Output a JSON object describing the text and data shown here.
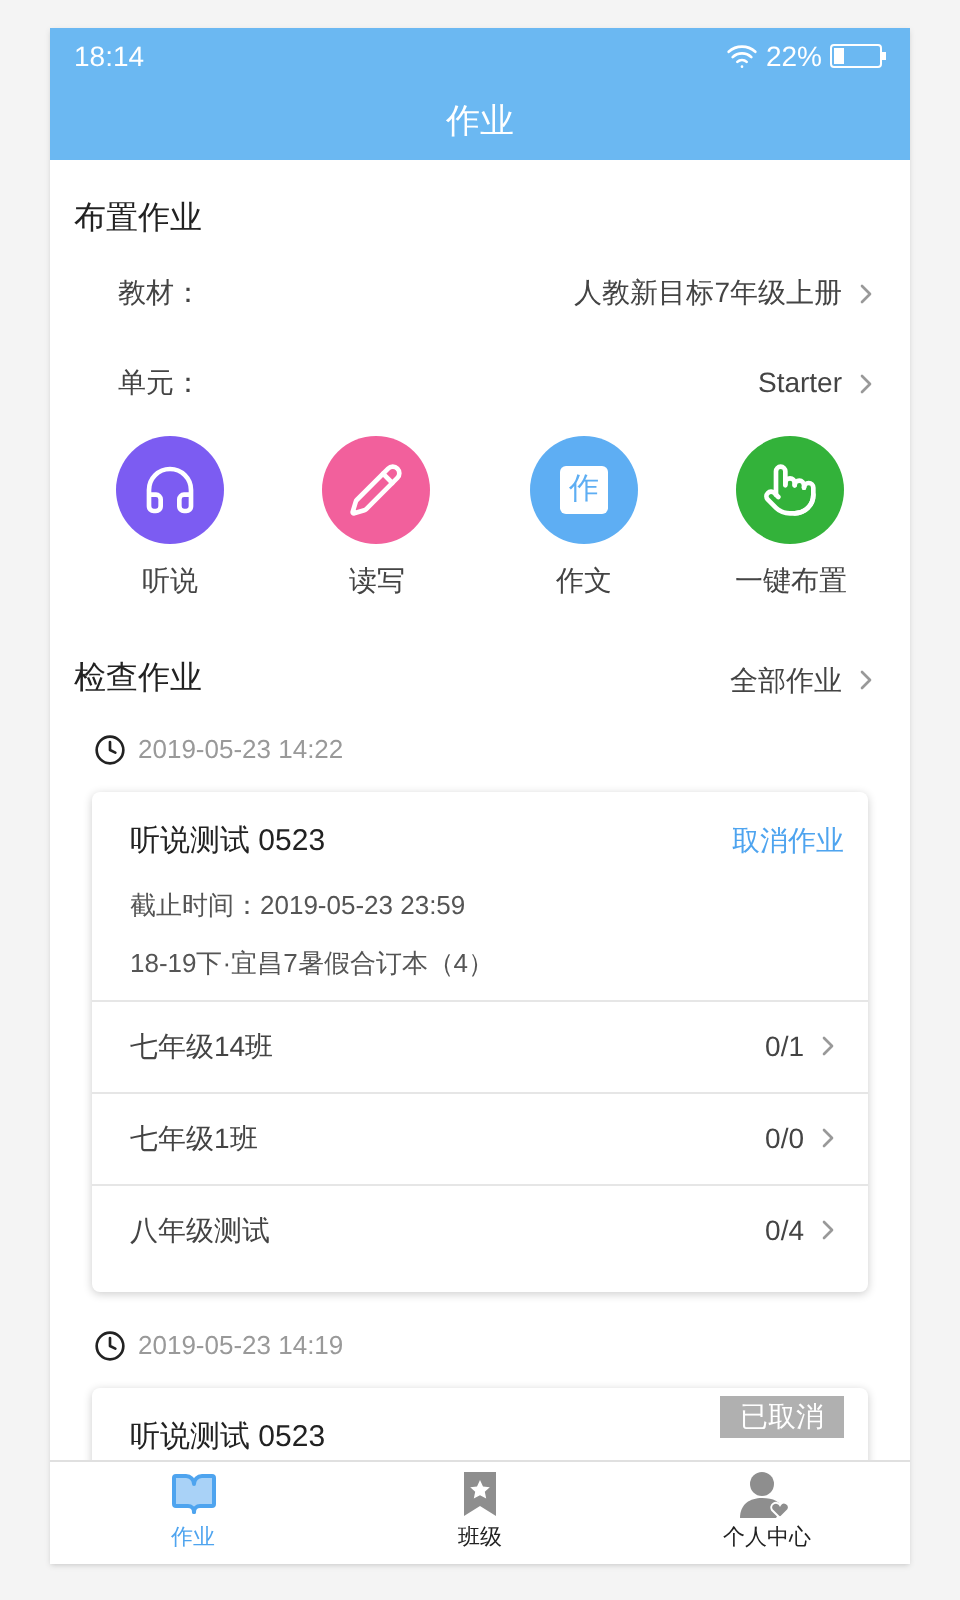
{
  "status_bar": {
    "time": "18:14",
    "battery": "22%"
  },
  "header": {
    "title": "作业"
  },
  "assign": {
    "title": "布置作业",
    "rows": [
      {
        "label": "教材：",
        "value": "人教新目标7年级上册"
      },
      {
        "label": "单元：",
        "value": "Starter"
      }
    ],
    "actions": [
      {
        "kind": "listen",
        "label": "听说",
        "color": "#7c5cf2"
      },
      {
        "kind": "write",
        "label": "读写",
        "color": "#f2609c"
      },
      {
        "kind": "essay",
        "label": "作文",
        "color": "#5eaef3",
        "icon_text": "作"
      },
      {
        "kind": "oneclick",
        "label": "一键布置",
        "color": "#33b23a"
      }
    ]
  },
  "check": {
    "title": "检查作业",
    "link": "全部作业",
    "groups": [
      {
        "date": "2019-05-23 14:22",
        "title": "听说测试 0523",
        "action": "取消作业",
        "deadline": "截止时间：2019-05-23 23:59",
        "book": "18-19下·宜昌7暑假合订本（4）",
        "classes": [
          {
            "name": "七年级14班",
            "count": "0/1"
          },
          {
            "name": "七年级1班",
            "count": "0/0"
          },
          {
            "name": "八年级测试",
            "count": "0/4"
          }
        ]
      },
      {
        "date": "2019-05-23 14:19",
        "title": "听说测试 0523",
        "badge": "已取消"
      }
    ]
  },
  "tabs": [
    {
      "kind": "book",
      "label": "作业",
      "selected": true
    },
    {
      "kind": "bookmark",
      "label": "班级",
      "selected": false
    },
    {
      "kind": "person",
      "label": "个人中心",
      "selected": false
    }
  ]
}
